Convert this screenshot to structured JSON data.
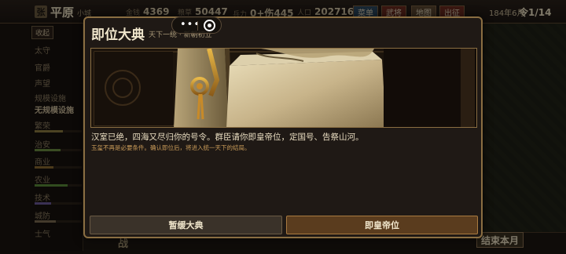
{
  "topbar": {
    "city_badge": "张",
    "city_name": "平原",
    "city_sub": "小城",
    "resources": [
      {
        "label": "金钱",
        "value": "4369"
      },
      {
        "label": "粮草",
        "value": "50447"
      },
      {
        "label": "兵力",
        "value": "0+伤445"
      },
      {
        "label": "人口",
        "value": "202716"
      }
    ],
    "menu_button": "菜单",
    "general_button": "武将",
    "map_button": "地图",
    "campaign_button": "出征",
    "date": "184年6月",
    "turn": "令1/14"
  },
  "leftpanel": {
    "collapse": "收起",
    "stats": [
      {
        "label": "太守"
      },
      {
        "label": "官爵"
      },
      {
        "label": "声望"
      },
      {
        "label": "规模设施"
      },
      {
        "label": "无规模设施"
      },
      {
        "label": "繁荣"
      },
      {
        "label": "治安"
      },
      {
        "label": "商业"
      },
      {
        "label": "农业"
      },
      {
        "label": "技术"
      },
      {
        "label": "城防"
      },
      {
        "label": "士气"
      }
    ]
  },
  "bottombar": {
    "tab_war": "战",
    "end_turn": "结束本月"
  },
  "modal": {
    "title": "即位大典",
    "subtitle": "天下一统 · 新朝初立",
    "text": "汉室已绝，四海又尽归你的号令。群臣请你即皇帝位，定国号、告祭山河。",
    "note": "玉玺不再是必要条件。确认即位后，将进入统一天下的结局。",
    "postpone_button": "暂缓大典",
    "ascend_button": "即皇帝位"
  },
  "capsule": {
    "dots": "•••"
  },
  "colors": {
    "accent_gold": "#8a6e42",
    "primary_button": "#5a3c1e",
    "secondary_button": "#3a3229",
    "note_text": "#c89a58"
  }
}
